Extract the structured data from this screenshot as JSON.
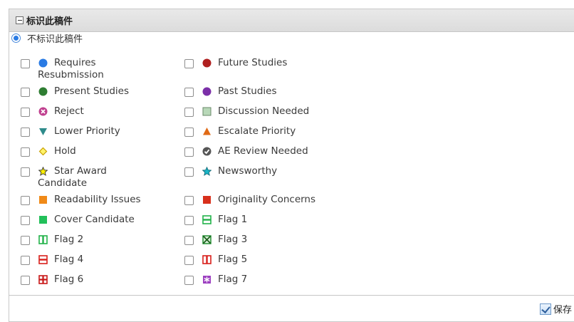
{
  "panel": {
    "title": "标识此稿件",
    "none_label": "不标识此稿件"
  },
  "flags": [
    {
      "label_line1": "Requires",
      "label_line2": "Resubmission",
      "icon": "blue-circle-icon",
      "color": "#2a7be4"
    },
    {
      "label_line1": "Future Studies",
      "icon": "dark-red-circle-icon",
      "color": "#b02020"
    },
    {
      "label_line1": "Present Studies",
      "icon": "green-circle-icon",
      "color": "#2e7d32"
    },
    {
      "label_line1": "Past Studies",
      "icon": "purple-circle-icon",
      "color": "#7b2fa8"
    },
    {
      "label_line1": "Reject",
      "icon": "reject-x-circle-icon",
      "color": "#c0408f"
    },
    {
      "label_line1": "Discussion Needed",
      "icon": "gray-green-square-icon",
      "color": "#9fc29f"
    },
    {
      "label_line1": "Lower Priority",
      "icon": "teal-down-triangle-icon",
      "color": "#2e8b8b"
    },
    {
      "label_line1": "Escalate Priority",
      "icon": "orange-up-triangle-icon",
      "color": "#e06a16"
    },
    {
      "label_line1": "Hold",
      "icon": "yellow-diamond-icon",
      "color": "#e6c000"
    },
    {
      "label_line1": "AE Review Needed",
      "icon": "check-circle-icon",
      "color": "#555555"
    },
    {
      "label_line1": "Star Award",
      "label_line2": "Candidate",
      "icon": "yellow-star-icon",
      "color": "#e6d400"
    },
    {
      "label_line1": "Newsworthy",
      "icon": "cyan-star-icon",
      "color": "#18b6c7"
    },
    {
      "label_line1": "Readability Issues",
      "icon": "orange-square-icon",
      "color": "#f08a18"
    },
    {
      "label_line1": "Originality Concerns",
      "icon": "red-square-icon",
      "color": "#d8301c"
    },
    {
      "label_line1": "Cover Candidate",
      "icon": "green-square-icon",
      "color": "#22c05a"
    },
    {
      "label_line1": "Flag 1",
      "icon": "green-hbar-box-icon",
      "color": "#22b24a"
    },
    {
      "label_line1": "Flag 2",
      "icon": "green-vbar-box-icon",
      "color": "#22b24a"
    },
    {
      "label_line1": "Flag 3",
      "icon": "green-x-box-icon",
      "color": "#1a8a2a"
    },
    {
      "label_line1": "Flag 4",
      "icon": "red-hbar-box-icon",
      "color": "#d8201c"
    },
    {
      "label_line1": "Flag 5",
      "icon": "red-vbar-box-icon",
      "color": "#d8201c"
    },
    {
      "label_line1": "Flag 6",
      "icon": "red-plus-box-icon",
      "color": "#c81818"
    },
    {
      "label_line1": "Flag 7",
      "icon": "purple-asterisk-box-icon",
      "color": "#9c3fc0"
    }
  ],
  "footer": {
    "save_label": "保存"
  }
}
